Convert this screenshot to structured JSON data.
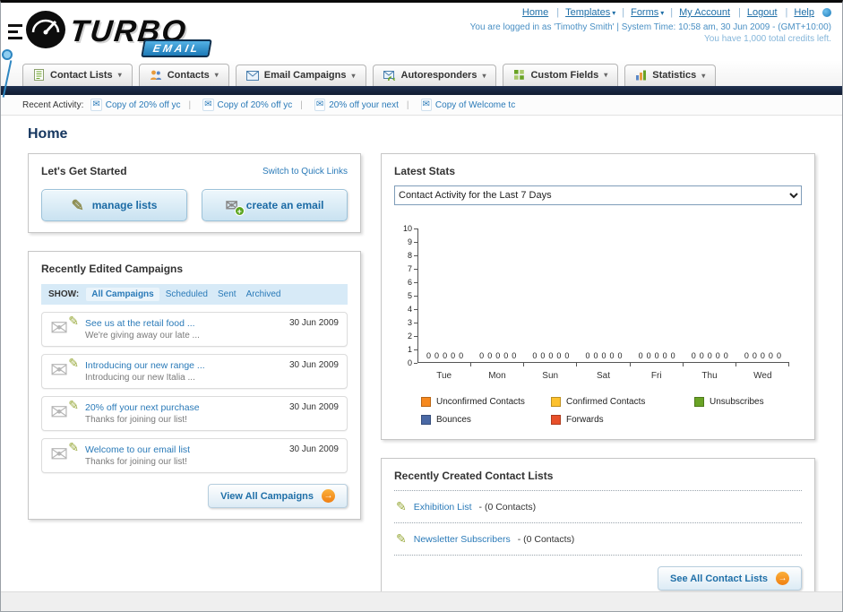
{
  "colors": {
    "link_blue": "#2a7ab8",
    "nav_bar_navy": "#16213a",
    "accent_orange": "#f5881f"
  },
  "header": {
    "logo_text": "TURBO",
    "logo_sub": "EMAIL",
    "nav_links": [
      {
        "label": "Home",
        "arrow": ""
      },
      {
        "label": "Templates",
        "arrow": "▾"
      },
      {
        "label": "Forms",
        "arrow": "▾"
      },
      {
        "label": "My Account",
        "arrow": ""
      },
      {
        "label": "Logout",
        "arrow": ""
      },
      {
        "label": "Help",
        "arrow": ""
      }
    ],
    "login_info": "You are logged in as 'Timothy Smith' | System Time: 10:58 am, 30 Jun 2009 - (GMT+10:00)",
    "credits_info": "You have 1,000 total credits left."
  },
  "main_nav": {
    "tabs": [
      {
        "label": "Contact Lists"
      },
      {
        "label": "Contacts"
      },
      {
        "label": "Email Campaigns"
      },
      {
        "label": "Autoresponders"
      },
      {
        "label": "Custom Fields"
      },
      {
        "label": "Statistics"
      }
    ]
  },
  "recent_activity": {
    "label": "Recent Activity:",
    "items": [
      "Copy of 20% off yc",
      "Copy of 20% off yc",
      "20% off your next",
      "Copy of Welcome tc"
    ]
  },
  "page": {
    "title": "Home"
  },
  "get_started": {
    "title": "Let's Get Started",
    "switch_link": "Switch to Quick Links",
    "manage_lists_label": "manage lists",
    "create_email_label": "create an email"
  },
  "campaigns": {
    "title": "Recently Edited Campaigns",
    "show_label": "SHOW:",
    "filter_tabs": [
      "All Campaigns",
      "Scheduled",
      "Sent",
      "Archived"
    ],
    "active_tab": "All Campaigns",
    "items": [
      {
        "title": "See us at the retail food ...",
        "subtitle": "We're giving away our late ...",
        "date": "30 Jun 2009"
      },
      {
        "title": "Introducing our new range ...",
        "subtitle": "Introducing our new Italia ...",
        "date": "30 Jun 2009"
      },
      {
        "title": "20% off your next purchase",
        "subtitle": "Thanks for joining our list!",
        "date": "30 Jun 2009"
      },
      {
        "title": "Welcome to our email list",
        "subtitle": "Thanks for joining our list!",
        "date": "30 Jun 2009"
      }
    ],
    "view_all_label": "View All Campaigns"
  },
  "stats": {
    "title": "Latest Stats",
    "selected_option": "Contact Activity for the Last 7 Days"
  },
  "chart_data": {
    "type": "bar",
    "title": "Contact Activity for the Last 7 Days",
    "categories": [
      "Tue",
      "Mon",
      "Sun",
      "Sat",
      "Fri",
      "Thu",
      "Wed"
    ],
    "series": [
      {
        "name": "Unconfirmed Contacts",
        "color": "#f6891f",
        "values": [
          0,
          0,
          0,
          0,
          0,
          0,
          0
        ]
      },
      {
        "name": "Confirmed Contacts",
        "color": "#fdc12d",
        "values": [
          0,
          0,
          0,
          0,
          0,
          0,
          0
        ]
      },
      {
        "name": "Unsubscribes",
        "color": "#69a325",
        "values": [
          0,
          0,
          0,
          0,
          0,
          0,
          0
        ]
      },
      {
        "name": "Bounces",
        "color": "#4a69a5",
        "values": [
          0,
          0,
          0,
          0,
          0,
          0,
          0
        ]
      },
      {
        "name": "Forwards",
        "color": "#e8502a",
        "values": [
          0,
          0,
          0,
          0,
          0,
          0,
          0
        ]
      }
    ],
    "xlabel": "",
    "ylabel": "",
    "ylim": [
      0,
      10
    ],
    "yticks": [
      0,
      1,
      2,
      3,
      4,
      5,
      6,
      7,
      8,
      9,
      10
    ],
    "grid": false,
    "legend_position": "bottom"
  },
  "contact_lists": {
    "title": "Recently Created Contact Lists",
    "items": [
      {
        "name": "Exhibition List",
        "suffix": " - (0 Contacts)"
      },
      {
        "name": "Newsletter Subscribers",
        "suffix": " - (0 Contacts)"
      }
    ],
    "see_all_label": "See All Contact Lists"
  }
}
